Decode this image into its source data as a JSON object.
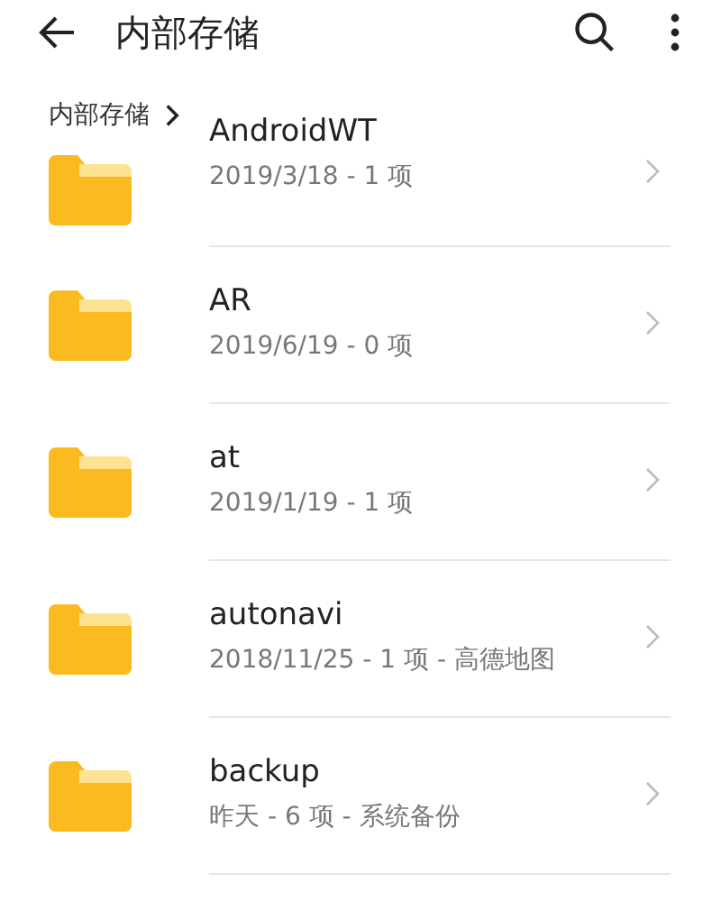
{
  "header": {
    "title": "内部存储"
  },
  "breadcrumb": [
    "内部存储"
  ],
  "folders": [
    {
      "name": "AndroidWT",
      "meta": "2019/3/18 - 1 项"
    },
    {
      "name": "AR",
      "meta": "2019/6/19 - 0 项"
    },
    {
      "name": "at",
      "meta": "2019/1/19 - 1 项"
    },
    {
      "name": "autonavi",
      "meta": "2018/11/25 - 1 项 - 高德地图"
    },
    {
      "name": "backup",
      "meta": "昨天 - 6 项 - 系统备份"
    }
  ]
}
